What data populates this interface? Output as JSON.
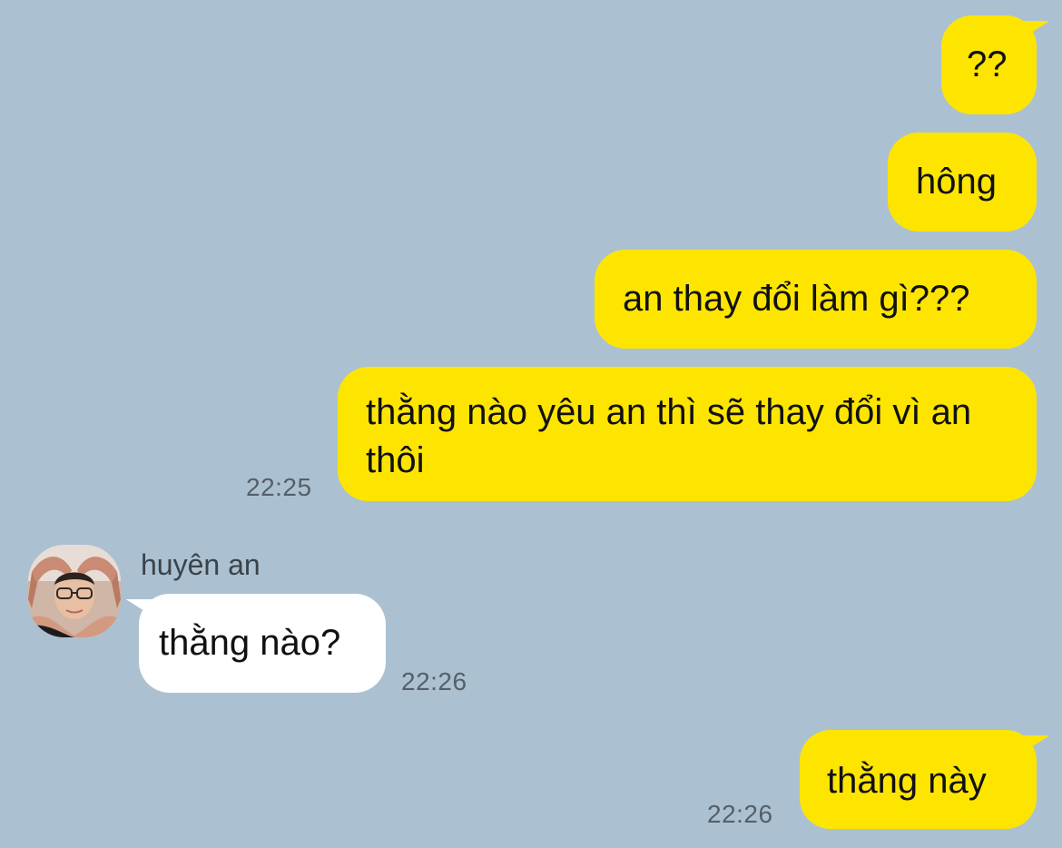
{
  "chat": {
    "messages": [
      {
        "from": "me",
        "text": "??"
      },
      {
        "from": "me",
        "text": "hông"
      },
      {
        "from": "me",
        "text": "an thay đổi làm gì???"
      },
      {
        "from": "me",
        "text": "thằng nào yêu an thì sẽ thay đổi vì an thôi",
        "time": "22:25"
      },
      {
        "from": "them",
        "sender": "huyên an",
        "text": "thằng nào?",
        "time": "22:26"
      },
      {
        "from": "me",
        "text": "thằng này",
        "time": "22:26"
      }
    ]
  },
  "colors": {
    "background": "#abc1d1",
    "sent_bubble": "#fee500",
    "received_bubble": "#ffffff",
    "timestamp": "#555f68"
  },
  "icons": {
    "avatar": "avatar-photo"
  }
}
